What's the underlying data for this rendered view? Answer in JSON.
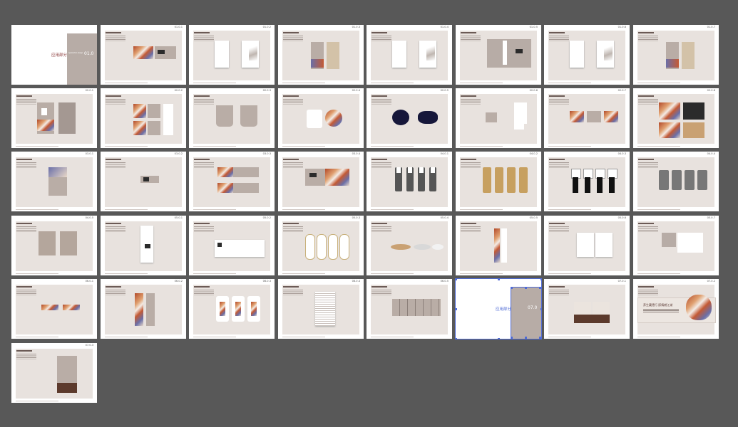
{
  "canvas": {
    "background": "#585858",
    "page_color": "#ffffff",
    "panel_color": "#e8e2de",
    "accent": "#b7aca6",
    "selection_color": "#4f6bd6"
  },
  "cover": {
    "title": "应用部分",
    "number": "01.0",
    "subtitle": "Application design"
  },
  "selected_cover": {
    "title": "应用部分",
    "number": "07.0"
  },
  "banner": {
    "text_line1": "养生藏德行 醉情朗江湖"
  },
  "pages": [
    {
      "n": "01.0",
      "type": "cover"
    },
    {
      "n": "01.0.1",
      "type": "tri-card"
    },
    {
      "n": "01.0.2",
      "type": "letter"
    },
    {
      "n": "01.0.3",
      "type": "envelope"
    },
    {
      "n": "01.0.4",
      "type": "letter"
    },
    {
      "n": "01.0.5",
      "type": "folder"
    },
    {
      "n": "01.0.6",
      "type": "letter"
    },
    {
      "n": "01.0.7",
      "type": "envelope"
    },
    {
      "n": "02.0.1",
      "type": "badge"
    },
    {
      "n": "02.0.2",
      "type": "cards4"
    },
    {
      "n": "02.0.3",
      "type": "cups"
    },
    {
      "n": "02.0.4",
      "type": "mug"
    },
    {
      "n": "02.0.5",
      "type": "coasters"
    },
    {
      "n": "02.0.6",
      "type": "stationery"
    },
    {
      "n": "02.0.7",
      "type": "cards3"
    },
    {
      "n": "02.0.8",
      "type": "giftcards"
    },
    {
      "n": "03.0.1",
      "type": "poster"
    },
    {
      "n": "03.0.2",
      "type": "sign"
    },
    {
      "n": "03.0.3",
      "type": "banners"
    },
    {
      "n": "03.0.4",
      "type": "boards"
    },
    {
      "n": "04.0.1",
      "type": "suits"
    },
    {
      "n": "04.0.2",
      "type": "uniforms"
    },
    {
      "n": "04.0.3",
      "type": "chefs"
    },
    {
      "n": "04.0.4",
      "type": "sportswear"
    },
    {
      "n": "04.0.5",
      "type": "tees"
    },
    {
      "n": "05.0.1",
      "type": "tall"
    },
    {
      "n": "05.0.2",
      "type": "wide"
    },
    {
      "n": "05.0.3",
      "type": "slippers"
    },
    {
      "n": "05.0.4",
      "type": "swooshes"
    },
    {
      "n": "05.0.5",
      "type": "tallprint"
    },
    {
      "n": "05.0.6",
      "type": "book"
    },
    {
      "n": "05.0.7",
      "type": "book2"
    },
    {
      "n": "06.0.1",
      "type": "labels"
    },
    {
      "n": "06.0.2",
      "type": "bottles"
    },
    {
      "n": "06.0.3",
      "type": "shirts"
    },
    {
      "n": "06.0.4",
      "type": "menu"
    },
    {
      "n": "06.0.5",
      "type": "table"
    },
    {
      "n": "07.0",
      "type": "selected-cover"
    },
    {
      "n": "07.0.1",
      "type": "brochure"
    },
    {
      "n": "07.0.2",
      "type": "banner"
    },
    {
      "n": "07.0.3",
      "type": "rollup"
    }
  ]
}
